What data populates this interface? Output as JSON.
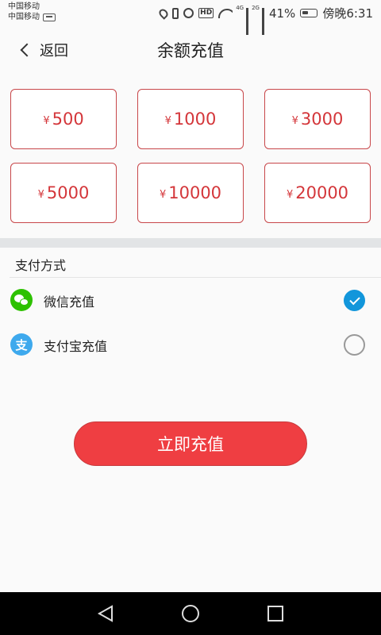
{
  "status_bar": {
    "carrier_1": "中国移动",
    "carrier_2": "中国移动",
    "network_4g": "4G",
    "network_2g": "2G",
    "hd_label": "HD",
    "battery": "41%",
    "time": "傍晚6:31"
  },
  "header": {
    "back_label": "返回",
    "title": "余额充值"
  },
  "amounts": [
    {
      "currency": "¥",
      "value": "500"
    },
    {
      "currency": "¥",
      "value": "1000"
    },
    {
      "currency": "¥",
      "value": "3000"
    },
    {
      "currency": "¥",
      "value": "5000"
    },
    {
      "currency": "¥",
      "value": "10000"
    },
    {
      "currency": "¥",
      "value": "20000"
    }
  ],
  "payment": {
    "section_title": "支付方式",
    "methods": [
      {
        "label": "微信充值",
        "icon": "wechat-icon",
        "color": "#2dc100",
        "selected": true
      },
      {
        "label": "支付宝充值",
        "icon": "alipay-icon",
        "glyph": "支",
        "color": "#3ea9ed",
        "selected": false
      }
    ]
  },
  "submit_label": "立即充值",
  "colors": {
    "accent_red": "#ef3e42",
    "amount_text": "#d4363a",
    "check_blue": "#1296db"
  }
}
